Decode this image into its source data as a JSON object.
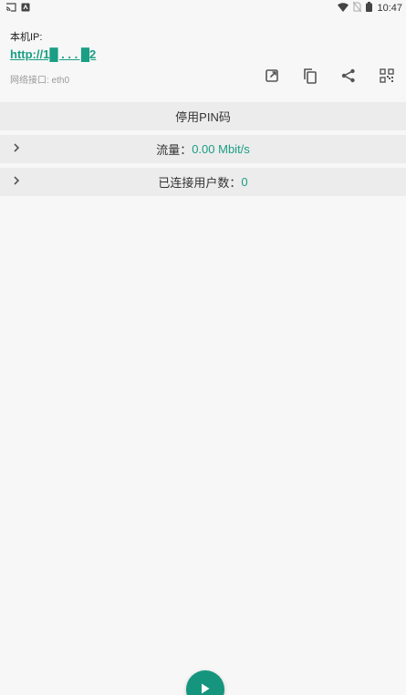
{
  "status_bar": {
    "time": "10:47",
    "left_icons": [
      "cast-icon",
      "app-notification-icon"
    ],
    "right_icons": [
      "wifi-icon",
      "no-sim-icon",
      "battery-icon"
    ]
  },
  "info": {
    "ip_label": "本机IP:",
    "url": "http://1█ . . . █2",
    "interface_label": "网络接口: eth0"
  },
  "actions": [
    "open-external-icon",
    "copy-icon",
    "share-icon",
    "qr-code-icon"
  ],
  "rows": {
    "pin": {
      "label": "停用PIN码"
    },
    "traffic": {
      "label": "流量：",
      "value": "0.00 Mbit/s"
    },
    "users": {
      "label": "已连接用户数：",
      "value": "0"
    }
  },
  "colors": {
    "accent": "#1a9e84",
    "fab": "#15957d"
  }
}
